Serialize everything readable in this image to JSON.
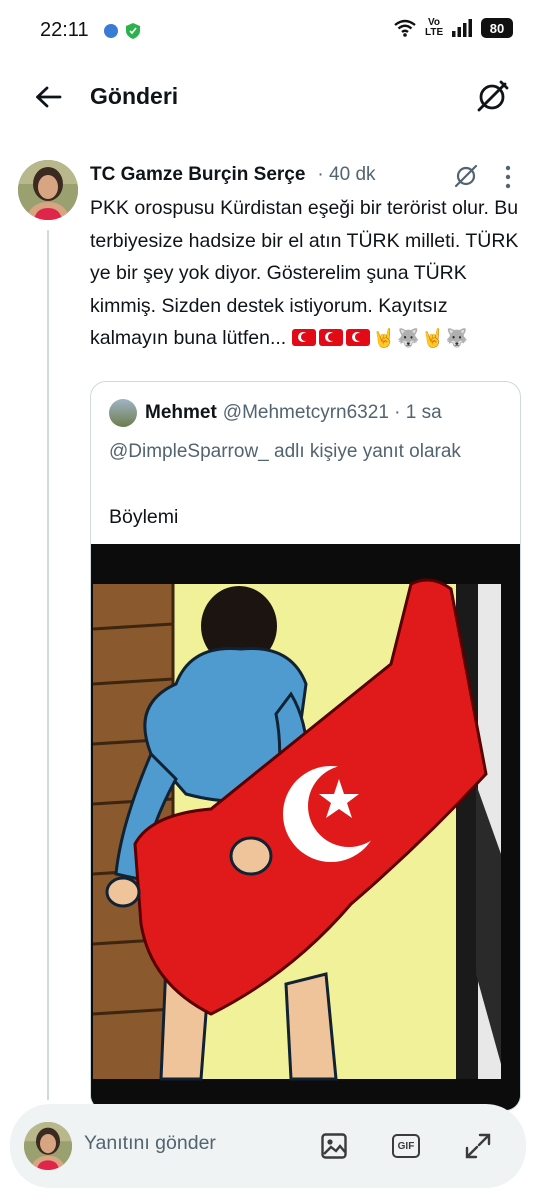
{
  "status_bar": {
    "time": "22:11",
    "network": "Vo LTE",
    "battery": "80"
  },
  "header": {
    "title": "Gönderi"
  },
  "tweet": {
    "author_name": "TC Gamze Burçin Serçe",
    "time": "· 40 dk",
    "text": "PKK orospusu Kürdistan eşeği bir terörist olur. Bu terbiyesize hadsize bir el atın TÜRK milleti. TÜRK ye bir şey yok diyor. Gösterelim şuna TÜRK kimmiş. Sizden destek istiyorum. Kayıtsız kalmayın buna lütfen...",
    "emojis": [
      "turkey-flag",
      "turkey-flag",
      "turkey-flag",
      "rock-hand",
      "wolf",
      "rock-hand",
      "wolf"
    ]
  },
  "quote": {
    "author_name": "Mehmet",
    "meta": "@Mehmetcyrn6321 · 1 sa",
    "reply_context": "@DimpleSparrow_ adlı kişiye yanıt olarak",
    "text": "Böylemi"
  },
  "reply_bar": {
    "placeholder": "Yanıtını gönder",
    "gif_label": "GIF"
  },
  "colors": {
    "accent_text": "#0f1419",
    "muted_text": "#536471",
    "border": "#cfd9de",
    "flag_red": "#e30a17"
  }
}
